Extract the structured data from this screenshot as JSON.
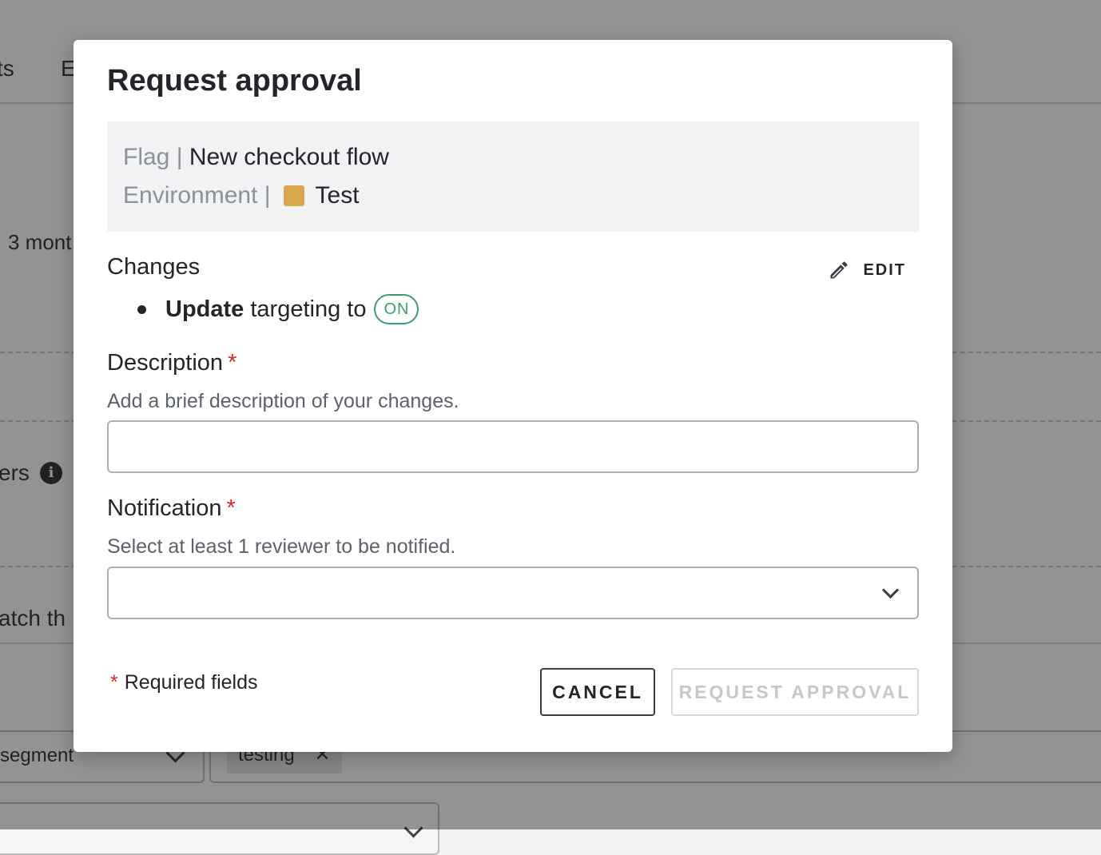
{
  "background": {
    "tab_partial_1": "ts",
    "tab_partial_2": "E",
    "time_partial": "3 mont",
    "section_partial": "ers",
    "match_partial": "atch th",
    "segment_select": "segment",
    "chip_label": "testing"
  },
  "modal": {
    "title": "Request approval",
    "summary": {
      "flag_label": "Flag |",
      "flag_name": "New checkout flow",
      "environment_label": "Environment |",
      "environment_name": "Test",
      "environment_color": "#d9a851"
    },
    "changes": {
      "label": "Changes",
      "edit_label": "EDIT",
      "items": [
        {
          "action": "Update",
          "text": "targeting to",
          "badge": "ON",
          "badge_color": "#3d9c6c"
        }
      ]
    },
    "description": {
      "label": "Description",
      "required_mark": "*",
      "helper": "Add a brief description of your changes.",
      "value": "",
      "placeholder": ""
    },
    "notification": {
      "label": "Notification",
      "required_mark": "*",
      "helper": "Select at least 1 reviewer to be notified.",
      "selected": ""
    },
    "footer": {
      "required_mark": "*",
      "required_note": "Required fields",
      "cancel_label": "CANCEL",
      "request_label": "REQUEST APPROVAL"
    }
  },
  "colors": {
    "required": "#d52b2b",
    "accent_green": "#3d9c6c",
    "overlay": "rgba(0,0,0,0.4)"
  }
}
